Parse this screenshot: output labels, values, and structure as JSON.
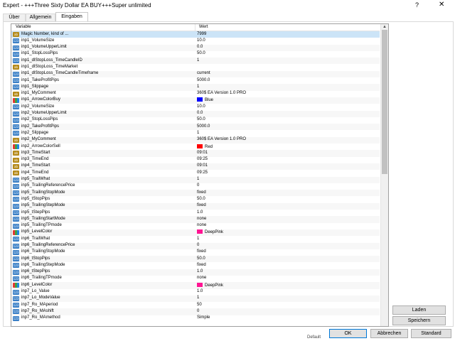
{
  "window": {
    "title": "Expert - +++Three Sixty Dollar EA BUY+++Super unlimited",
    "help_label": "?",
    "close_label": "✕"
  },
  "tabs": [
    {
      "label": "Über",
      "active": false
    },
    {
      "label": "Allgemein",
      "active": false
    },
    {
      "label": "Eingaben",
      "active": true
    }
  ],
  "grid": {
    "columns": {
      "variable": "Variable",
      "value": "Wert"
    },
    "rows": [
      {
        "icon": "ab",
        "name": "Magic Number, kind of ...",
        "value": "7999",
        "selected": true
      },
      {
        "icon": "123",
        "name": "inp1_VolumeSize",
        "value": "10.0"
      },
      {
        "icon": "123",
        "name": "inp1_VolumeUpperLimit",
        "value": "0.0"
      },
      {
        "icon": "123",
        "name": "inp1_StopLossPips",
        "value": "50.0"
      },
      {
        "icon": "123",
        "name": "inp1_dlStopLoss_TimeCandleID",
        "value": "1"
      },
      {
        "icon": "ab",
        "name": "inp1_dlStopLoss_TimeMarket",
        "value": ""
      },
      {
        "icon": "123",
        "name": "inp1_dlStopLoss_TimeCandleTimeframe",
        "value": "current"
      },
      {
        "icon": "123",
        "name": "inp1_TakeProfitPips",
        "value": "5000.0"
      },
      {
        "icon": "123",
        "name": "inp1_Slippage",
        "value": "1"
      },
      {
        "icon": "ab",
        "name": "inp1_MyComment",
        "value": "360$ EA Version 1.0 PRO"
      },
      {
        "icon": "clr",
        "name": "inp1_ArrowColorBuy",
        "value": "Blue",
        "swatch": "#0000ff"
      },
      {
        "icon": "123",
        "name": "inp2_VolumeSize",
        "value": "10.0"
      },
      {
        "icon": "123",
        "name": "inp2_VolumeUpperLimit",
        "value": "0.0"
      },
      {
        "icon": "123",
        "name": "inp2_StopLossPips",
        "value": "50.0"
      },
      {
        "icon": "123",
        "name": "inp2_TakeProfitPips",
        "value": "5000.0"
      },
      {
        "icon": "123",
        "name": "inp2_Slippage",
        "value": "1"
      },
      {
        "icon": "ab",
        "name": "inp2_MyComment",
        "value": "360$ EA Version 1.0 PRO"
      },
      {
        "icon": "clr",
        "name": "inp2_ArrowColorSell",
        "value": "Red",
        "swatch": "#ff0000"
      },
      {
        "icon": "ab",
        "name": "inp3_TimeStart",
        "value": "09:01"
      },
      {
        "icon": "ab",
        "name": "inp3_TimeEnd",
        "value": "09:25"
      },
      {
        "icon": "ab",
        "name": "inp4_TimeStart",
        "value": "09:01"
      },
      {
        "icon": "ab",
        "name": "inp4_TimeEnd",
        "value": "09:25"
      },
      {
        "icon": "123",
        "name": "inp5_TrailWhat",
        "value": "1"
      },
      {
        "icon": "123",
        "name": "inp5_TrailingReferencePrice",
        "value": "0"
      },
      {
        "icon": "123",
        "name": "inp5_TrailingStopMode",
        "value": "fixed"
      },
      {
        "icon": "123",
        "name": "inp5_tStopPips",
        "value": "50.0"
      },
      {
        "icon": "123",
        "name": "inp5_TrailingStepMode",
        "value": "fixed"
      },
      {
        "icon": "123",
        "name": "inp5_tStepPips",
        "value": "1.0"
      },
      {
        "icon": "123",
        "name": "inp5_TrailingStartMode",
        "value": "none"
      },
      {
        "icon": "123",
        "name": "inp5_TrailingTPmode",
        "value": "none"
      },
      {
        "icon": "clr",
        "name": "inp5_LevelColor",
        "value": "DeepPink",
        "swatch": "#ff1493"
      },
      {
        "icon": "123",
        "name": "inp6_TrailWhat",
        "value": "1"
      },
      {
        "icon": "123",
        "name": "inp6_TrailingReferencePrice",
        "value": "0"
      },
      {
        "icon": "123",
        "name": "inp6_TrailingStopMode",
        "value": "fixed"
      },
      {
        "icon": "123",
        "name": "inp6_tStopPips",
        "value": "50.0"
      },
      {
        "icon": "123",
        "name": "inp6_TrailingStepMode",
        "value": "fixed"
      },
      {
        "icon": "123",
        "name": "inp6_tStepPips",
        "value": "1.0"
      },
      {
        "icon": "123",
        "name": "inp6_TrailingTPmode",
        "value": "none"
      },
      {
        "icon": "clr",
        "name": "inp6_LevelColor",
        "value": "DeepPink",
        "swatch": "#ff1493"
      },
      {
        "icon": "123",
        "name": "inp7_Lo_Value",
        "value": "1.0"
      },
      {
        "icon": "123",
        "name": "inp7_Lo_ModeValue",
        "value": "1"
      },
      {
        "icon": "123",
        "name": "inp7_Ro_MAperiod",
        "value": "50"
      },
      {
        "icon": "123",
        "name": "inp7_Ro_MAshift",
        "value": "0"
      },
      {
        "icon": "123",
        "name": "inp7_Ro_MAmethod",
        "value": "Simple"
      }
    ]
  },
  "buttons": {
    "load": "Laden",
    "save": "Speichern",
    "ok": "OK",
    "cancel": "Abbrechen",
    "reset": "Standard"
  },
  "status": {
    "text": "Default"
  }
}
